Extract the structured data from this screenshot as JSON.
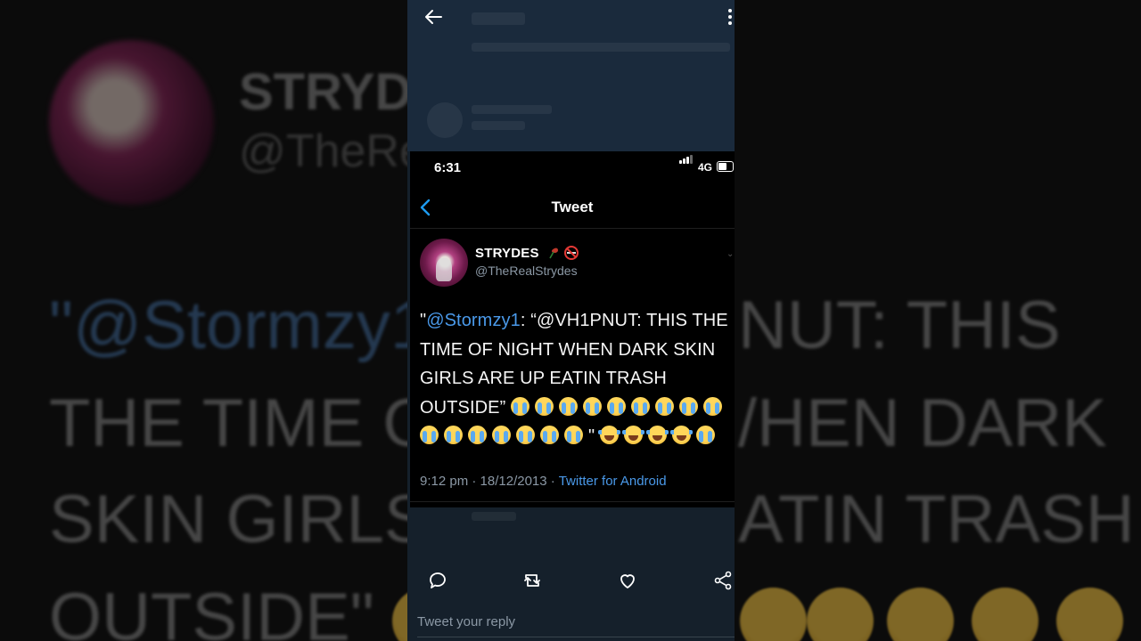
{
  "background": {
    "name": "STRYDE",
    "handle": "@TheRe",
    "line1_mention": "\"@Stormzy1",
    "line1_right": "NUT: THIS",
    "line2_left": "THE TIME O",
    "line2_right": "/HEN DARK",
    "line3_left": "SKIN GIRLS",
    "line3_right": "ATIN TRASH",
    "line4_left": "OUTSIDE\""
  },
  "app": {
    "back_icon": "arrow-left-icon",
    "more_icon": "more-vertical-icon"
  },
  "status_bar": {
    "time": "6:31",
    "network": "4G",
    "battery_level": 0.6
  },
  "nav": {
    "title": "Tweet"
  },
  "tweet": {
    "display_name": "STRYDES",
    "handle": "@TheRealStrydes",
    "text_open_quote": "\"",
    "mention": "@Stormzy1",
    "text_body": ": “@VH1PNUT: THIS THE TIME OF NIGHT WHEN DARK SKIN GIRLS ARE UP EATIN TRASH OUTSIDE”",
    "text_close_quote": "\"",
    "time": "9:12 pm",
    "date": "18/12/2013",
    "source": "Twitter for Android"
  },
  "actions": {
    "reply_icon": "comment-icon",
    "retweet_icon": "retweet-icon",
    "like_icon": "heart-icon",
    "share_icon": "share-icon"
  },
  "reply": {
    "placeholder": "Tweet your reply"
  },
  "colors": {
    "accent": "#4a99e9",
    "app_bg": "#15202b",
    "muted": "#8b98a5"
  }
}
